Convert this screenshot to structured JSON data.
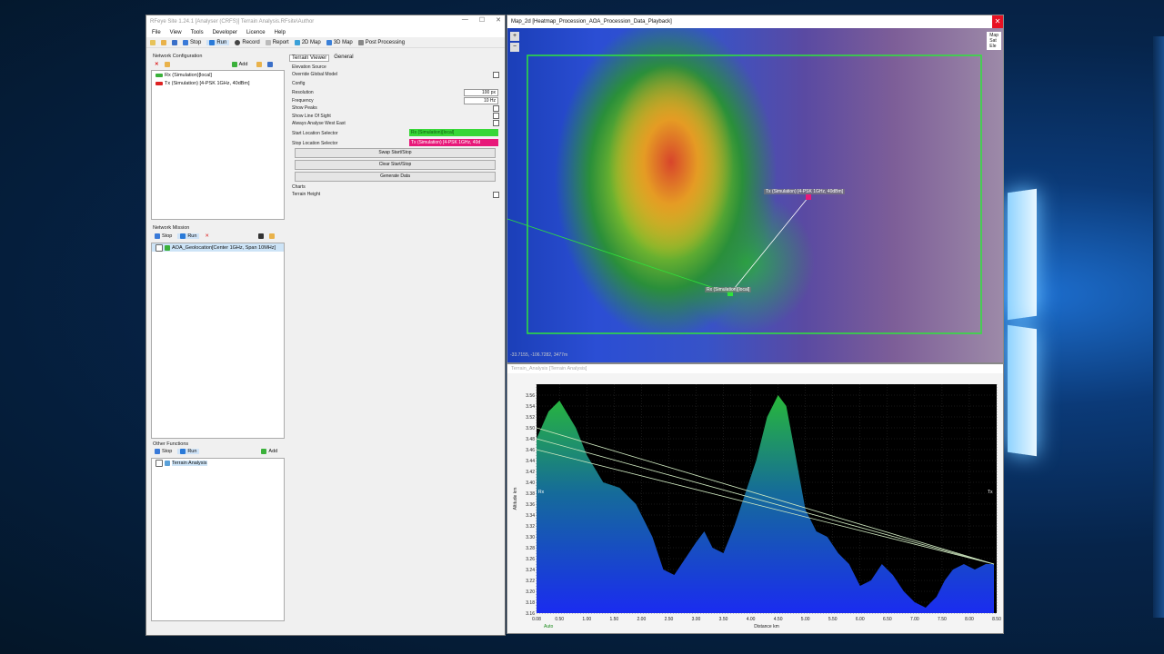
{
  "app": {
    "title": "RFeye Site 1.24.1 [Analyser (CRFS)] Terrain Analysis.RFsite\\Author",
    "menu": [
      "File",
      "View",
      "Tools",
      "Developer",
      "Licence",
      "Help"
    ],
    "toolbar": {
      "stop": "Stop",
      "run": "Run",
      "record": "Record",
      "report": "Report",
      "map2d": "2D Map",
      "map3d": "3D Map",
      "post": "Post Processing"
    }
  },
  "network_config": {
    "label": "Network Configuration",
    "add": "Add",
    "items": [
      "Rx (Simulation)[local]",
      "Tx (Simulation) [4-PSK 1GHz, 40dBm]"
    ]
  },
  "props": {
    "tabs": [
      "Terrain Viewer",
      "General"
    ],
    "rows": {
      "elevation": "Elevation Source",
      "override": "Override Global Model",
      "config": "Config",
      "resolution": "Resolution",
      "frequency": "Frequency",
      "show_peaks": "Show Peaks",
      "show_los": "Show Line Of Sight",
      "always": "Always Analyse West East",
      "start_sel": "Start Location Selector",
      "stop_sel": "Stop Location Selector",
      "charts": "Charts",
      "terrain_height": "Terrain Height"
    },
    "resolution_value": "100 px",
    "frequency_value": "10 Hz",
    "start_value": "Rx (Simulation)[local]",
    "stop_value": "Tx (Simulation) [4-PSK 1GHz, 40d",
    "buttons": {
      "swap": "Swap Start/Stop",
      "clear": "Clear Start/Stop",
      "generate": "Generate Data"
    }
  },
  "network_mission": {
    "label": "Network Mission",
    "stop": "Stop",
    "run": "Run",
    "item": "AOA_Geolocation[Center 1GHz, Span 10MHz]"
  },
  "other_functions": {
    "label": "Other Functions",
    "stop": "Stop",
    "run": "Run",
    "add": "Add",
    "item": "Terrain Analysis"
  },
  "map": {
    "title": "Map_2d [Heatmap_Procession_AOA_Procession_Data_Playback]",
    "layers": [
      "Map",
      "Sat",
      "Ele"
    ],
    "tx_label": "Tx (Simulation) [4-PSK 1GHz, 40dBm]",
    "rx_label": "Rx (Simulation)[local]",
    "coords": "-33.7155, -106.7282, 3477m"
  },
  "analysis": {
    "title": "Terrain_Analysis [Terrain Analysis]",
    "rx": "Rx",
    "tx": "Tx",
    "auto": "Auto"
  },
  "colors": {
    "start_sel": "#37d737",
    "stop_sel": "#e8197a",
    "map_rect": "#2ee53a"
  },
  "chart_data": {
    "type": "area",
    "xlabel": "Distance km",
    "ylabel": "Altitude km",
    "xlim": [
      0.08,
      8.5
    ],
    "ylim": [
      3.16,
      3.58
    ],
    "xticks": [
      0.08,
      0.5,
      1.0,
      1.5,
      2.0,
      2.5,
      3.0,
      3.5,
      4.0,
      4.5,
      5.0,
      5.5,
      6.0,
      6.5,
      7.0,
      7.5,
      8.0,
      8.5
    ],
    "yticks": [
      3.16,
      3.18,
      3.2,
      3.22,
      3.24,
      3.26,
      3.28,
      3.3,
      3.32,
      3.34,
      3.36,
      3.38,
      3.4,
      3.42,
      3.44,
      3.46,
      3.48,
      3.5,
      3.52,
      3.54,
      3.56
    ],
    "series": [
      {
        "x": [
          0.08,
          0.3,
          0.5,
          0.8,
          1.0,
          1.3,
          1.6,
          1.9,
          2.2,
          2.4,
          2.6,
          2.8,
          3.0,
          3.15,
          3.3,
          3.5,
          3.7,
          3.9,
          4.1,
          4.3,
          4.5,
          4.65,
          4.8,
          5.0,
          5.2,
          5.4,
          5.6,
          5.8,
          6.0,
          6.2,
          6.4,
          6.6,
          6.8,
          7.0,
          7.2,
          7.4,
          7.55,
          7.7,
          7.9,
          8.1,
          8.3,
          8.45
        ],
        "y": [
          3.48,
          3.53,
          3.55,
          3.5,
          3.45,
          3.4,
          3.39,
          3.36,
          3.3,
          3.24,
          3.23,
          3.26,
          3.29,
          3.31,
          3.28,
          3.27,
          3.32,
          3.38,
          3.44,
          3.52,
          3.56,
          3.54,
          3.46,
          3.35,
          3.31,
          3.3,
          3.27,
          3.25,
          3.21,
          3.22,
          3.25,
          3.23,
          3.2,
          3.18,
          3.17,
          3.19,
          3.22,
          3.24,
          3.25,
          3.24,
          3.25,
          3.25
        ]
      }
    ],
    "los_lines": [
      {
        "x": [
          0.08,
          8.45
        ],
        "y": [
          3.5,
          3.25
        ]
      },
      {
        "x": [
          0.08,
          8.45
        ],
        "y": [
          3.48,
          3.25
        ]
      },
      {
        "x": [
          0.08,
          8.45
        ],
        "y": [
          3.46,
          3.25
        ]
      }
    ]
  }
}
